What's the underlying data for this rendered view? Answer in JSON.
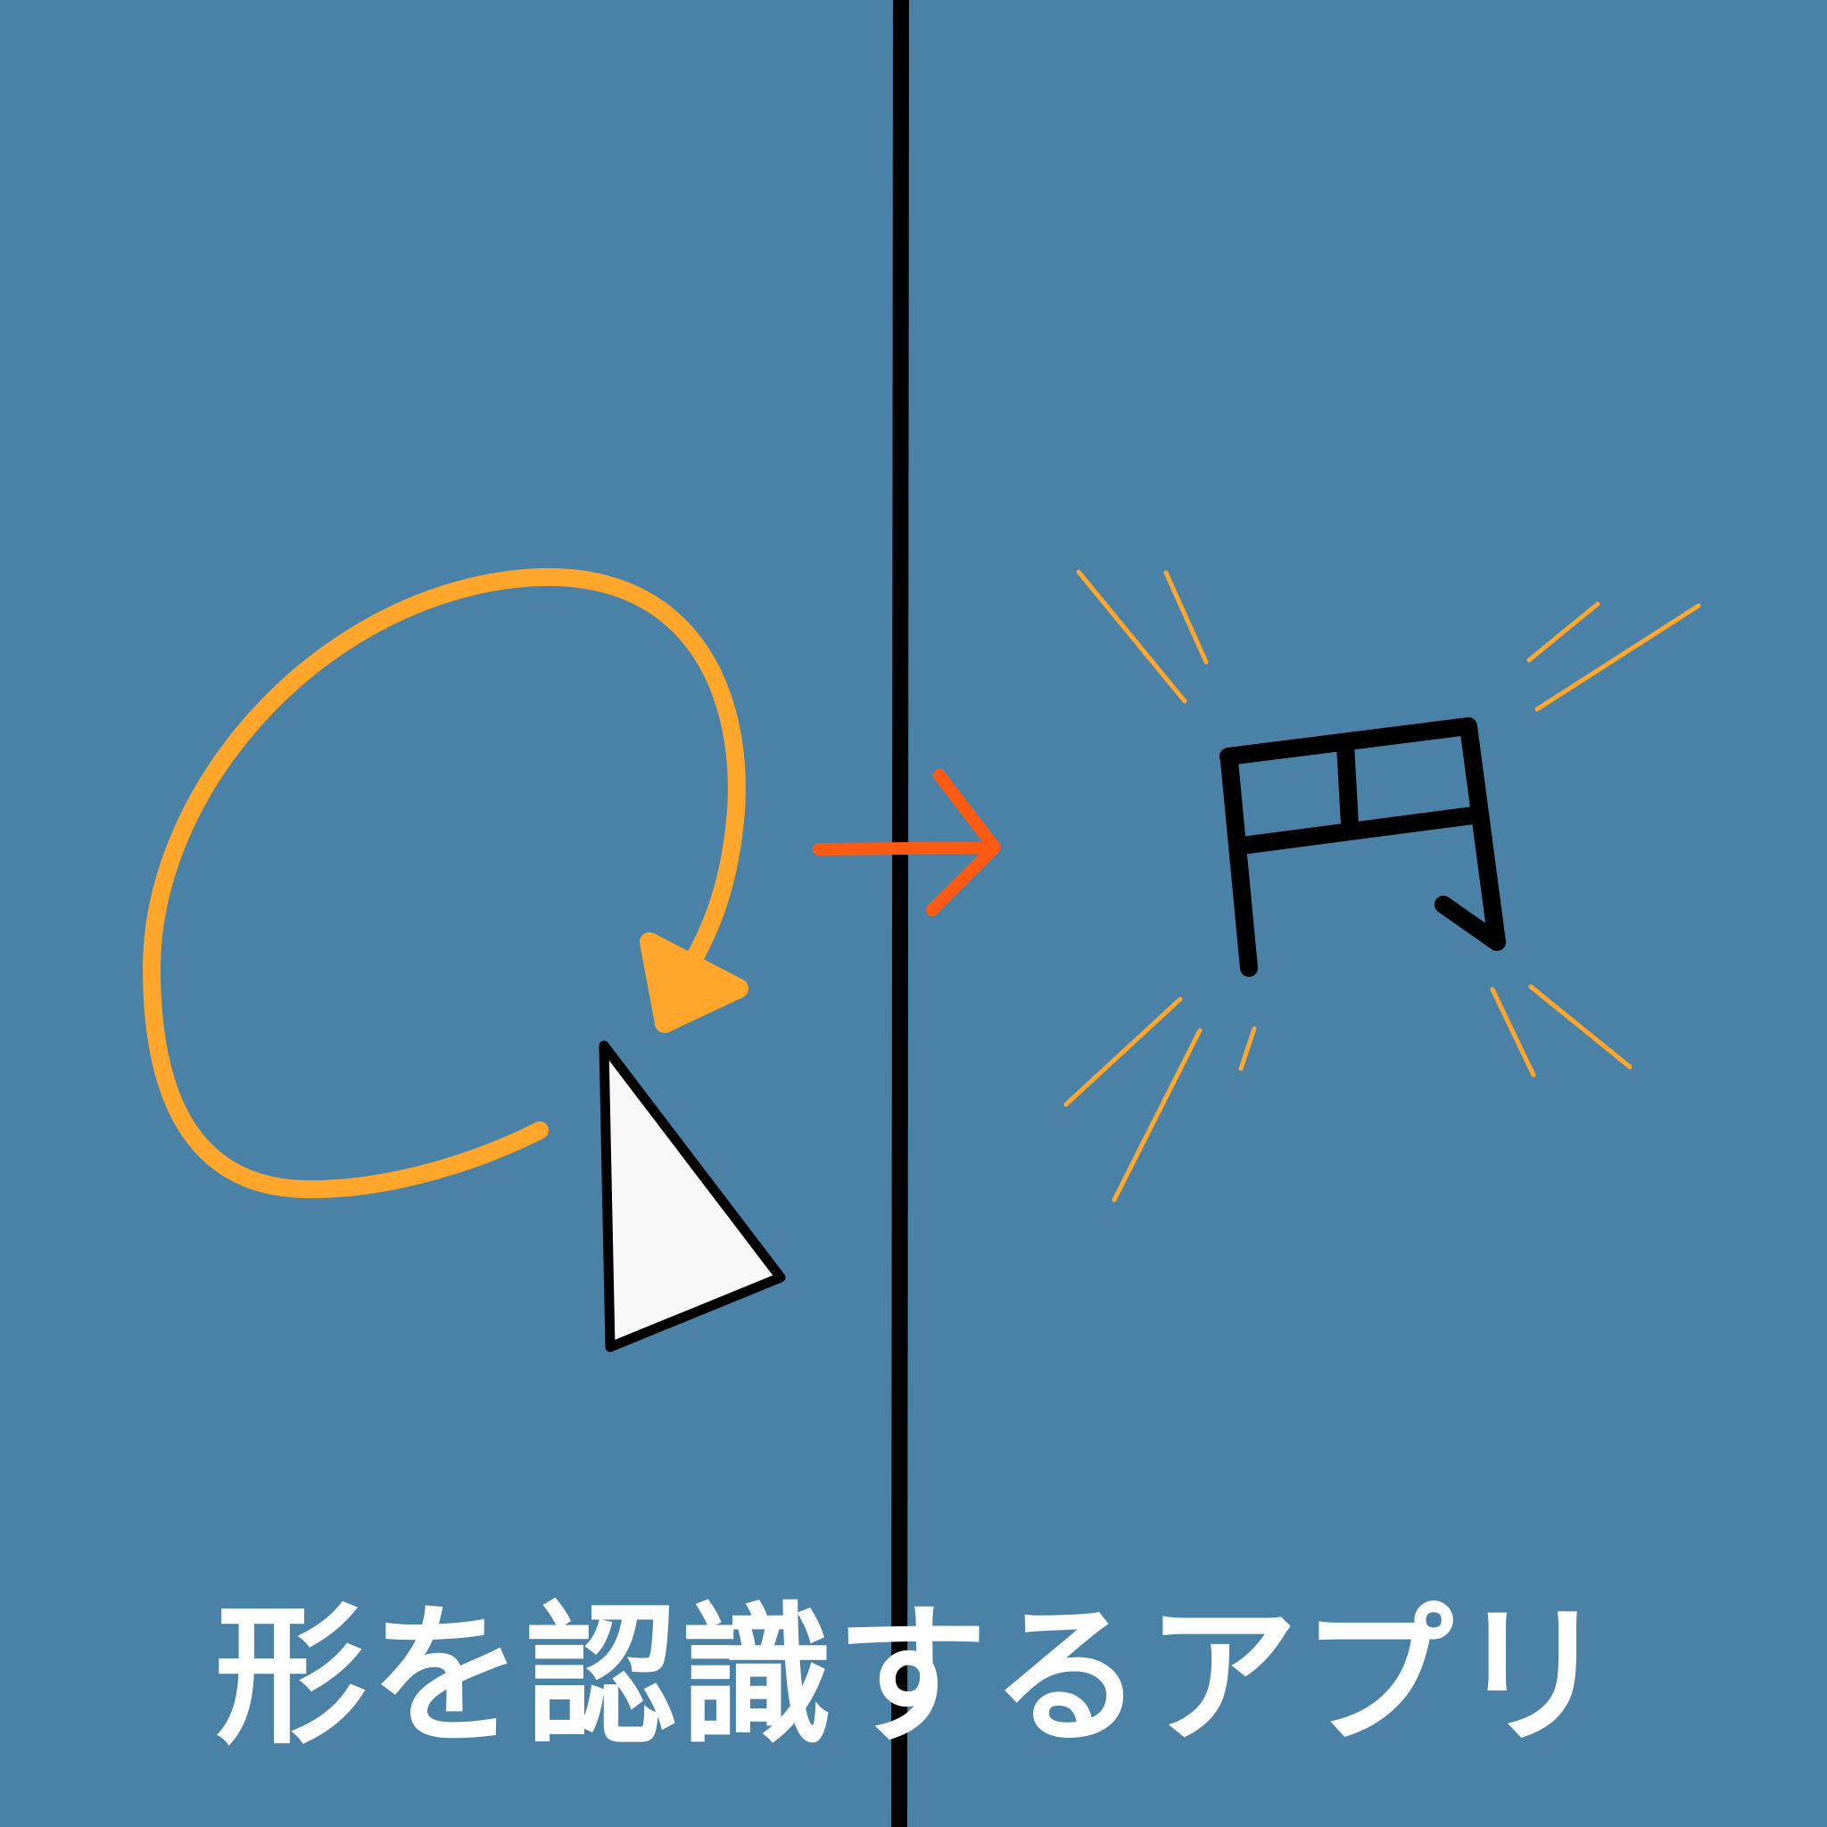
{
  "caption": "形を認識するアプリ",
  "result_label": "円",
  "colors": {
    "background": "#4a81a7",
    "stroke_orange": "#ffa62b",
    "arrow_red_orange": "#ff5a14",
    "divider": "#000000",
    "cursor_fill": "#f8f8f8",
    "cursor_outline": "#000000",
    "caption_text": "#ffffff"
  },
  "icons": {
    "drawn_stroke": "circular-gesture-arrow-icon",
    "cursor": "pointer-cursor-icon",
    "transition": "right-arrow-icon",
    "sparkle": "sparkle-lines-icon"
  }
}
